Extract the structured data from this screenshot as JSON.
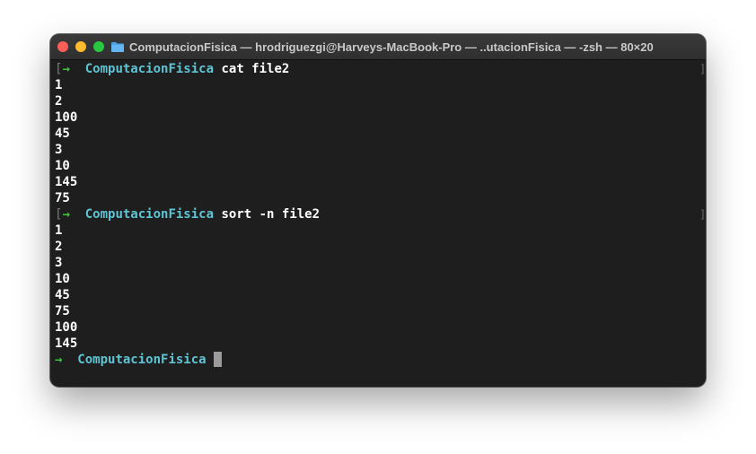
{
  "window": {
    "title": "ComputacionFisica — hrodriguezgi@Harveys-MacBook-Pro — ..utacionFisica — -zsh — 80×20",
    "icon": "folder-icon"
  },
  "terminal": {
    "prompt_symbol": "→",
    "directory": "ComputacionFisica",
    "commands": [
      "cat file2",
      "sort -n file2"
    ],
    "cat_output": [
      "1",
      "2",
      "100",
      "45",
      "3",
      "10",
      "145",
      "75"
    ],
    "sort_output": [
      "1",
      "2",
      "3",
      "10",
      "45",
      "75",
      "100",
      "145"
    ],
    "right_marker": "]",
    "left_marker": "["
  },
  "colors": {
    "prompt_arrow": "#3ec43e",
    "directory": "#5fc4d4",
    "background": "#1e1e1e"
  }
}
